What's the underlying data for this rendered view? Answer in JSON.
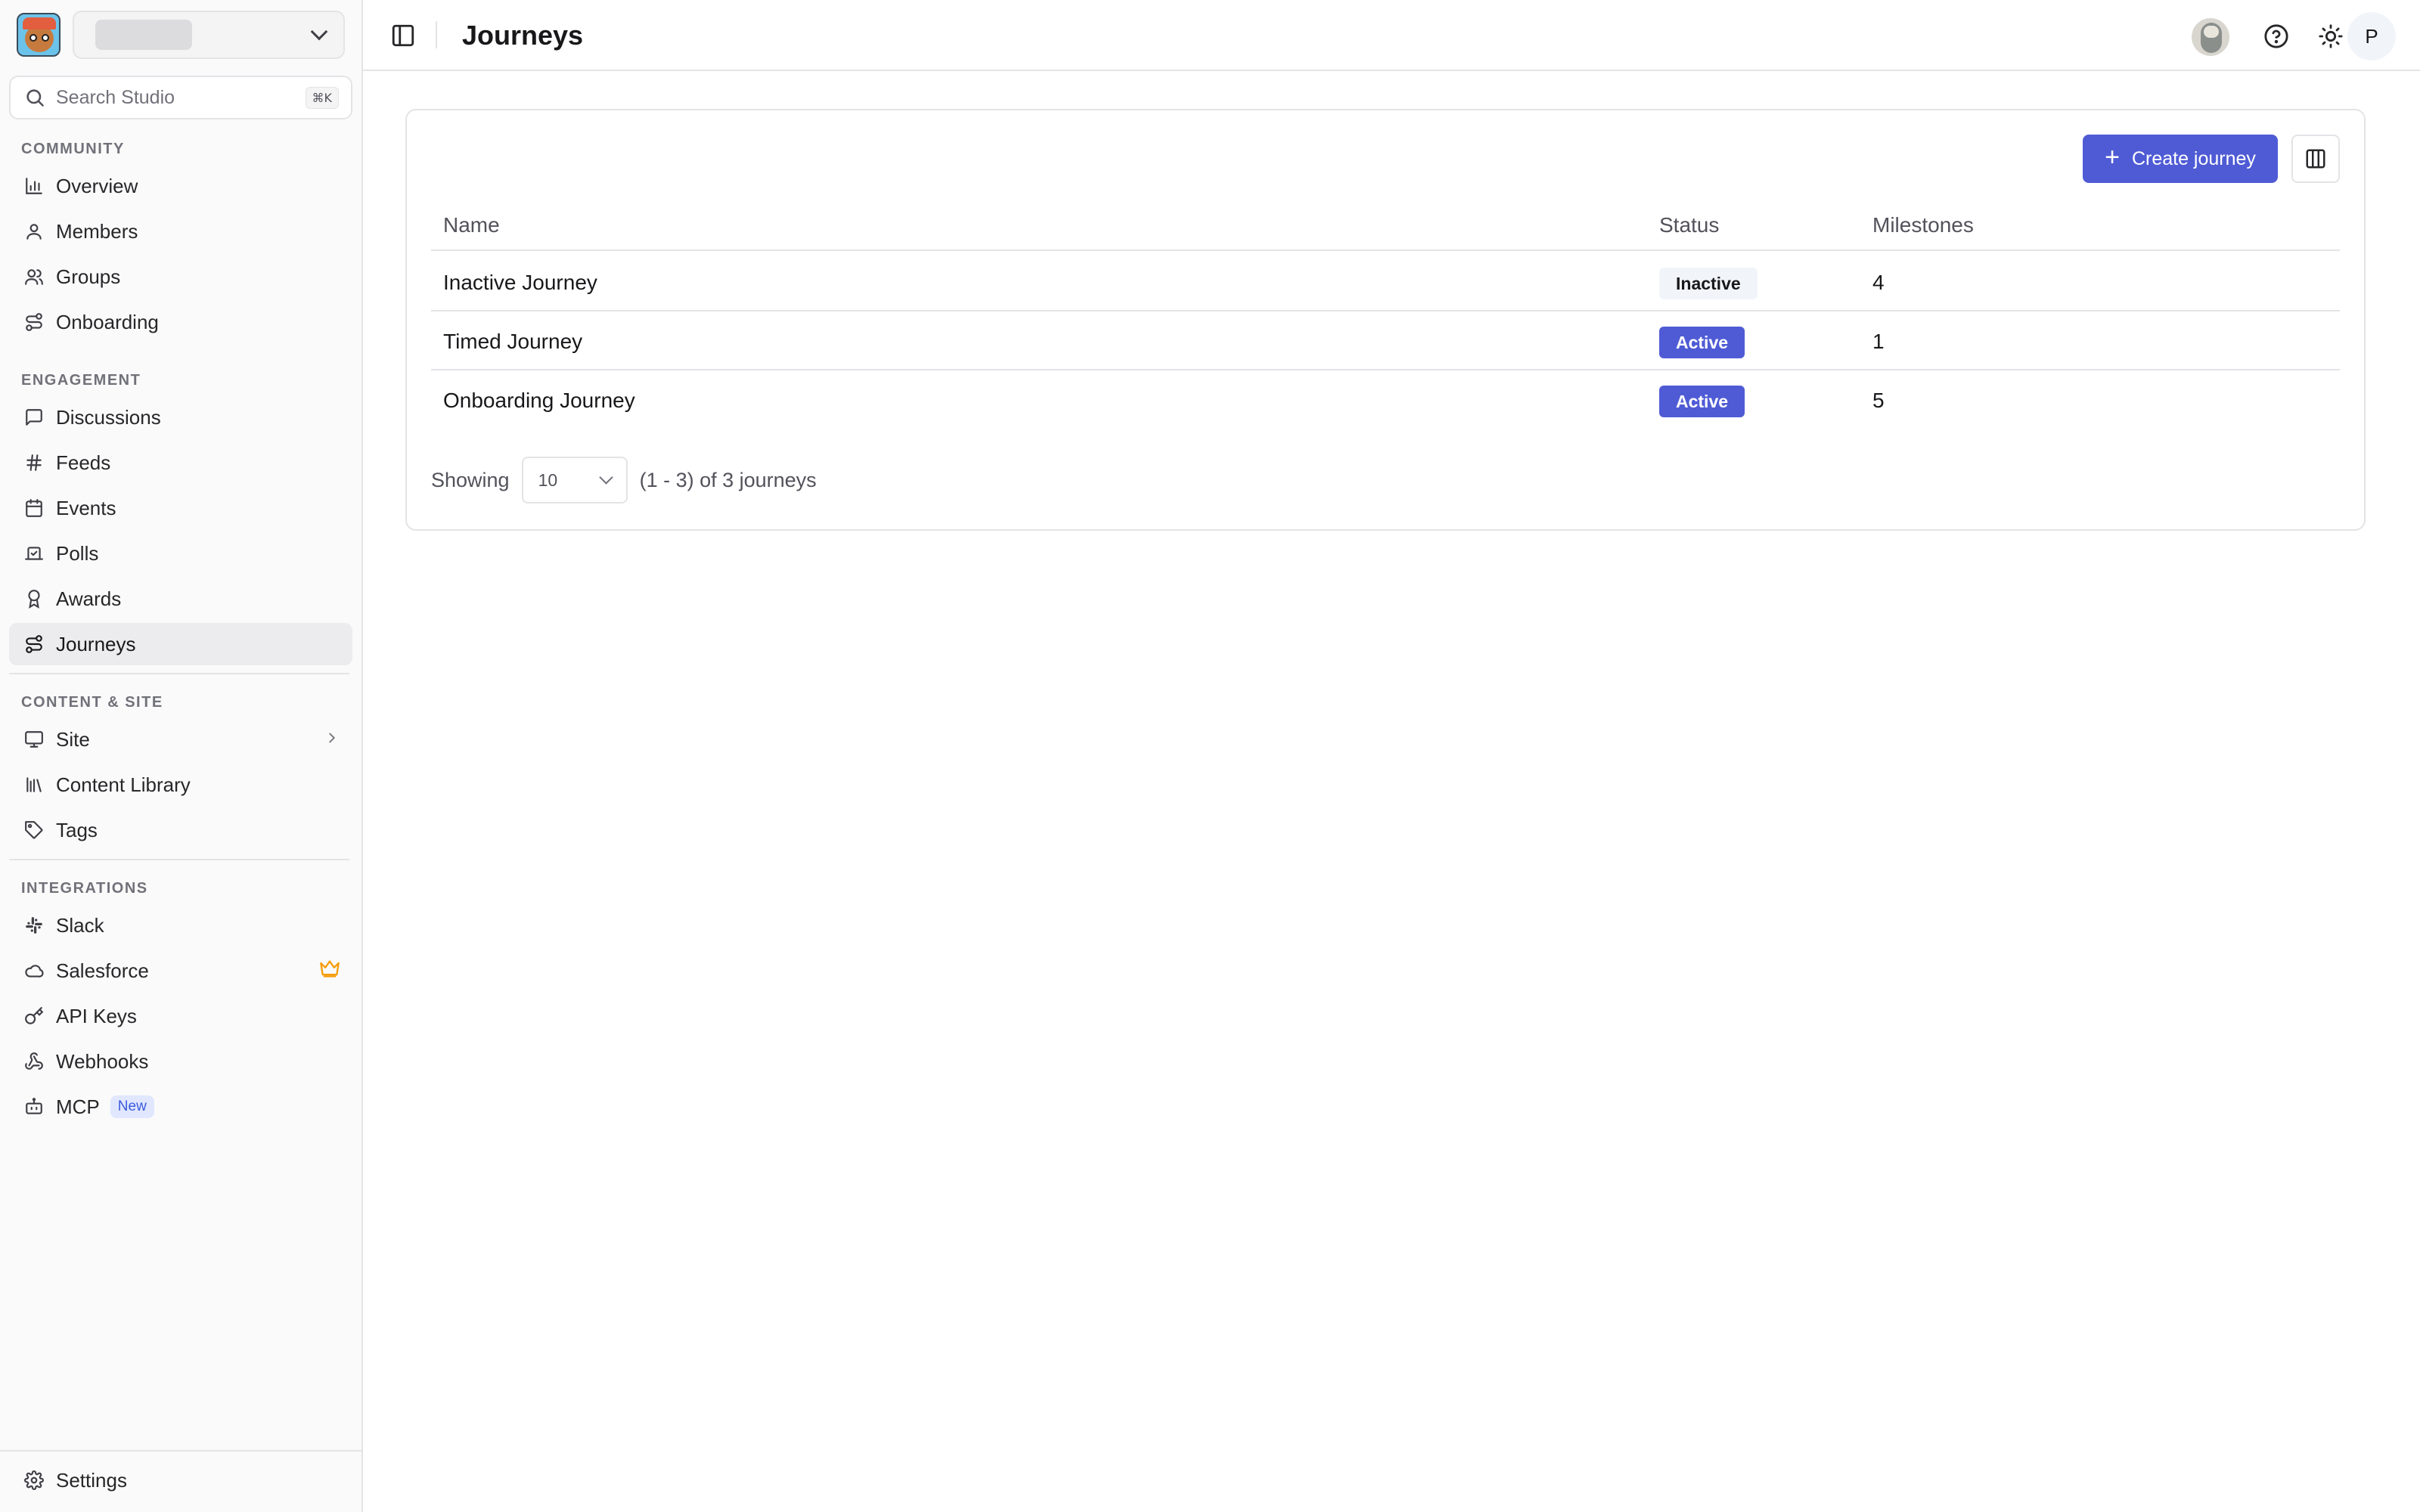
{
  "sidebar": {
    "search": {
      "placeholder": "Search Studio",
      "shortcut": "⌘K"
    },
    "sections": {
      "community": "COMMUNITY",
      "engagement": "ENGAGEMENT",
      "content_site": "CONTENT & SITE",
      "integrations": "INTEGRATIONS"
    },
    "items": {
      "overview": "Overview",
      "members": "Members",
      "groups": "Groups",
      "onboarding": "Onboarding",
      "discussions": "Discussions",
      "feeds": "Feeds",
      "events": "Events",
      "polls": "Polls",
      "awards": "Awards",
      "journeys": "Journeys",
      "site": "Site",
      "content_library": "Content Library",
      "tags": "Tags",
      "slack": "Slack",
      "salesforce": "Salesforce",
      "api_keys": "API Keys",
      "webhooks": "Webhooks",
      "mcp": "MCP",
      "mcp_badge": "New",
      "settings": "Settings"
    },
    "active_item": "journeys"
  },
  "header": {
    "title": "Journeys",
    "user_initial": "P"
  },
  "toolbar": {
    "create_label": "Create journey"
  },
  "table": {
    "columns": [
      "Name",
      "Status",
      "Milestones"
    ],
    "rows": [
      {
        "name": "Inactive Journey",
        "status": "Inactive",
        "milestones": "4"
      },
      {
        "name": "Timed Journey",
        "status": "Active",
        "milestones": "1"
      },
      {
        "name": "Onboarding Journey",
        "status": "Active",
        "milestones": "5"
      }
    ]
  },
  "pagination": {
    "showing_label": "Showing",
    "page_size": "10",
    "range_text": "(1 - 3) of 3 journeys"
  },
  "colors": {
    "accent": "#4f5bd5",
    "premium_crown": "#f59e0b"
  }
}
